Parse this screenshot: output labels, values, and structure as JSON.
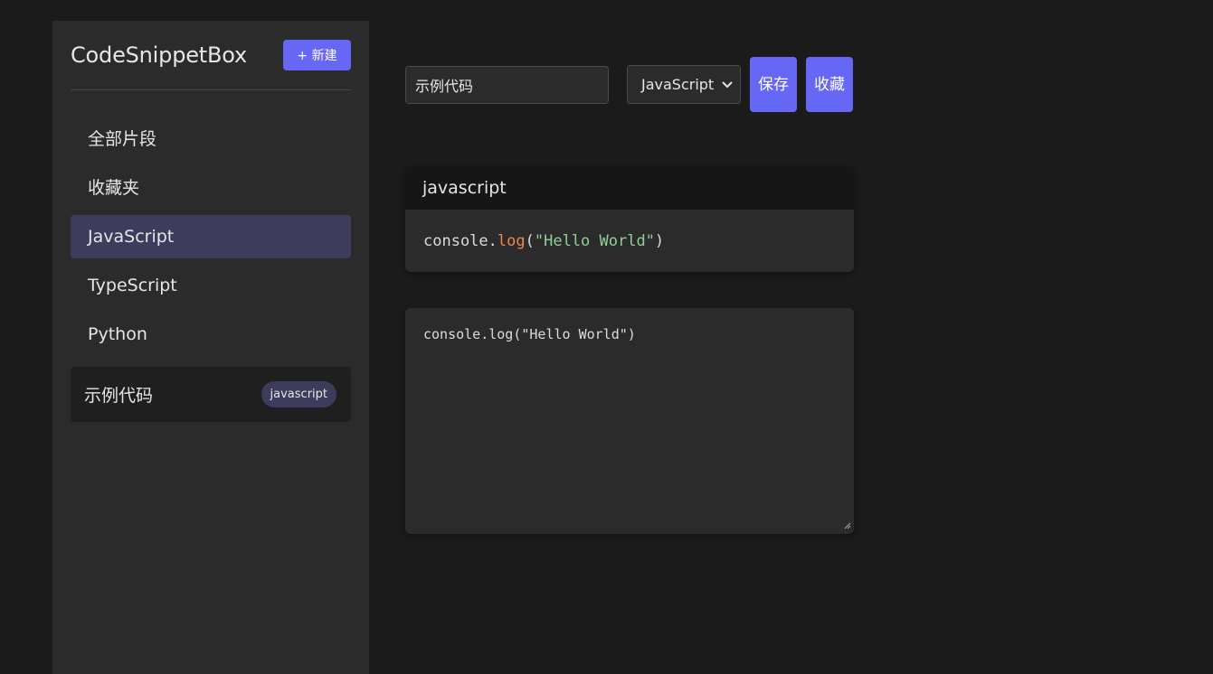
{
  "app": {
    "title": "CodeSnippetBox"
  },
  "sidebar": {
    "new_button_icon": "plus-icon",
    "new_button_label": "+ 新建",
    "nav": [
      {
        "label": "全部片段",
        "active": false
      },
      {
        "label": "收藏夹",
        "active": false
      },
      {
        "label": "JavaScript",
        "active": true
      },
      {
        "label": "TypeScript",
        "active": false
      },
      {
        "label": "Python",
        "active": false
      }
    ],
    "snippets": [
      {
        "title": "示例代码",
        "tag": "javascript"
      }
    ]
  },
  "editor_toolbar": {
    "title_value": "示例代码",
    "language_selected": "JavaScript",
    "save_label": "保存",
    "favorite_label": "收藏"
  },
  "preview": {
    "language": "javascript",
    "code_tokens": [
      {
        "text": "console.",
        "kind": "plain"
      },
      {
        "text": "log",
        "kind": "fn"
      },
      {
        "text": "(",
        "kind": "plain"
      },
      {
        "text": "\"Hello World\"",
        "kind": "str"
      },
      {
        "text": ")",
        "kind": "plain"
      }
    ]
  },
  "editor": {
    "code": "console.log(\"Hello World\")"
  },
  "colors": {
    "accent": "#6667f4",
    "active_nav": "#3d3c5c",
    "background": "#1b1b1b",
    "panel": "#2b2b2b"
  }
}
